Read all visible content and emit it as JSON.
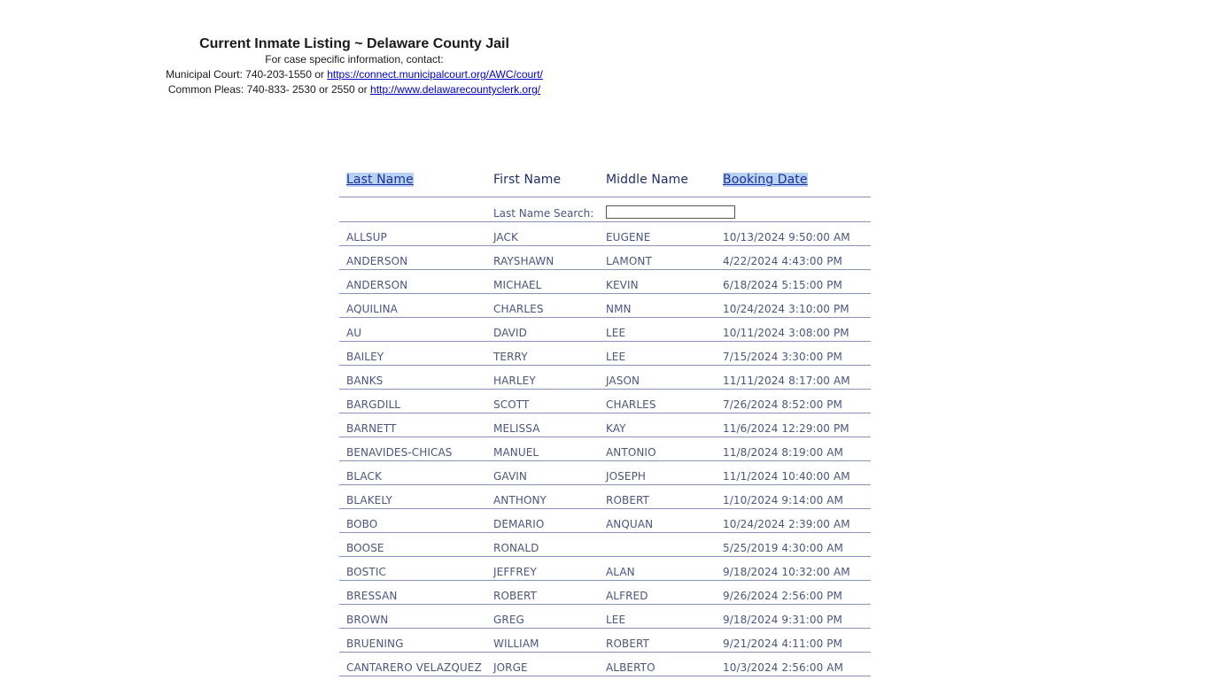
{
  "header": {
    "title": "Current Inmate Listing ~ Delaware County Jail",
    "line1": "For case specific information, contact:",
    "municipal_prefix": "Municipal Court: 740-203-1550 or ",
    "municipal_link": "https://connect.municipalcourt.org/AWC/court/",
    "pleas_prefix": "Common Pleas: 740-833- 2530 or 2550 or ",
    "pleas_link": "http://www.delawarecountyclerk.org/"
  },
  "columns": {
    "last_name": "Last Name",
    "first_name": "First Name",
    "middle_name": "Middle Name",
    "booking_date": "Booking Date"
  },
  "search": {
    "label": "Last Name Search:",
    "value": ""
  },
  "rows": [
    {
      "last": "ALLSUP",
      "first": "JACK",
      "middle": "EUGENE",
      "date": "10/13/2024 9:50:00 AM"
    },
    {
      "last": "ANDERSON",
      "first": "RAYSHAWN",
      "middle": "LAMONT",
      "date": "4/22/2024 4:43:00 PM"
    },
    {
      "last": "ANDERSON",
      "first": "MICHAEL",
      "middle": "KEVIN",
      "date": "6/18/2024 5:15:00 PM"
    },
    {
      "last": "AQUILINA",
      "first": "CHARLES",
      "middle": "NMN",
      "date": "10/24/2024 3:10:00 PM"
    },
    {
      "last": "AU",
      "first": "DAVID",
      "middle": "LEE",
      "date": "10/11/2024 3:08:00 PM"
    },
    {
      "last": "BAILEY",
      "first": "TERRY",
      "middle": "LEE",
      "date": "7/15/2024 3:30:00 PM"
    },
    {
      "last": "BANKS",
      "first": "HARLEY",
      "middle": "JASON",
      "date": "11/11/2024 8:17:00 AM"
    },
    {
      "last": "BARGDILL",
      "first": "SCOTT",
      "middle": "CHARLES",
      "date": "7/26/2024 8:52:00 PM"
    },
    {
      "last": "BARNETT",
      "first": "MELISSA",
      "middle": "KAY",
      "date": "11/6/2024 12:29:00 PM"
    },
    {
      "last": "BENAVIDES-CHICAS",
      "first": "MANUEL",
      "middle": "ANTONIO",
      "date": "11/8/2024 8:19:00 AM"
    },
    {
      "last": "BLACK",
      "first": "GAVIN",
      "middle": "JOSEPH",
      "date": "11/1/2024 10:40:00 AM"
    },
    {
      "last": "BLAKELY",
      "first": "ANTHONY",
      "middle": "ROBERT",
      "date": "1/10/2024 9:14:00 AM"
    },
    {
      "last": "BOBO",
      "first": "DEMARIO",
      "middle": "ANQUAN",
      "date": "10/24/2024 2:39:00 AM"
    },
    {
      "last": "BOOSE",
      "first": "RONALD",
      "middle": "",
      "date": "5/25/2019 4:30:00 AM"
    },
    {
      "last": "BOSTIC",
      "first": "JEFFREY",
      "middle": "ALAN",
      "date": "9/18/2024 10:32:00 AM"
    },
    {
      "last": "BRESSAN",
      "first": "ROBERT",
      "middle": "ALFRED",
      "date": "9/26/2024 2:56:00 PM"
    },
    {
      "last": "BROWN",
      "first": "GREG",
      "middle": "LEE",
      "date": "9/18/2024 9:31:00 PM"
    },
    {
      "last": "BRUENING",
      "first": "WILLIAM",
      "middle": "ROBERT",
      "date": "9/21/2024 4:11:00 PM"
    },
    {
      "last": "CANTARERO VELAZQUEZ",
      "first": "JORGE",
      "middle": "ALBERTO",
      "date": "10/3/2024 2:56:00 AM"
    }
  ]
}
